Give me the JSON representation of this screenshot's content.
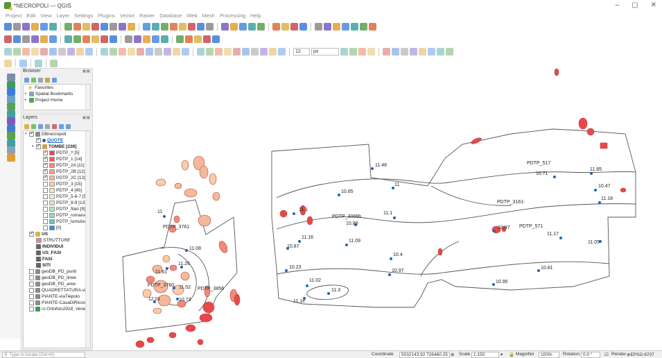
{
  "window": {
    "title": "*NECROPOLI — QGIS",
    "controls": [
      "–",
      "▢",
      "✕"
    ]
  },
  "menu": [
    "Project",
    "Edit",
    "View",
    "Layer",
    "Settings",
    "Plugins",
    "Vector",
    "Raster",
    "Database",
    "Web",
    "Mesh",
    "Processing",
    "Help"
  ],
  "toolbar": {
    "font_size_value": "12",
    "unit_value": "px"
  },
  "browser": {
    "title": "Browser",
    "items": [
      {
        "label": "Favorites",
        "icon": "star-icon"
      },
      {
        "label": "Spatial Bookmarks",
        "icon": "bookmark-icon"
      },
      {
        "label": "Project Home",
        "icon": "folder-icon"
      }
    ]
  },
  "layers": {
    "title": "Layers",
    "items": [
      {
        "label": "DBnecropoli",
        "indent": 0,
        "checked": true,
        "kind": "db",
        "expand": "▾"
      },
      {
        "label": "QUOTE",
        "indent": 1,
        "checked": true,
        "kind": "point",
        "bold": true,
        "underline": true,
        "color": "#1f63b7"
      },
      {
        "label": "TOMBE [228]",
        "indent": 1,
        "checked": true,
        "kind": "polygon",
        "bold": true,
        "expand": "▾"
      },
      {
        "label": "PDTP_? [5]",
        "indent": 2,
        "checked": true,
        "swatch": "#e9474b"
      },
      {
        "label": "PDTP_1 [14]",
        "indent": 2,
        "checked": true,
        "swatch": "#ea5f5e"
      },
      {
        "label": "PDTP_2A [11]",
        "indent": 2,
        "checked": true,
        "swatch": "#f08a78"
      },
      {
        "label": "PDTP_2B [12]",
        "indent": 2,
        "checked": true,
        "swatch": "#f1a087"
      },
      {
        "label": "PDTP_2C [13]",
        "indent": 2,
        "checked": true,
        "swatch": "#f4b89a"
      },
      {
        "label": "PDTP_3 [15]",
        "indent": 2,
        "checked": false,
        "swatch": "#f7cdaa"
      },
      {
        "label": "PDTP_4 [45]",
        "indent": 2,
        "checked": false,
        "swatch": "#fbe0bd"
      },
      {
        "label": "PDTP_5-6-7 [53]",
        "indent": 2,
        "checked": false,
        "swatch": "#eef0c8"
      },
      {
        "label": "PDTP_8-9 [13]",
        "indent": 2,
        "checked": false,
        "swatch": "#d4ecc4"
      },
      {
        "label": "PDTP_filari [9]",
        "indent": 2,
        "checked": false,
        "swatch": "#b9e0bf"
      },
      {
        "label": "PDTP_romana [26]",
        "indent": 2,
        "checked": false,
        "swatch": "#9bd3c3"
      },
      {
        "label": "PDTP_tumuloA [12",
        "indent": 2,
        "checked": false,
        "swatch": "#6fc0c8"
      },
      {
        "label": "[0]",
        "indent": 2,
        "checked": false,
        "swatch": "#2f8fd0"
      },
      {
        "label": "US",
        "indent": 0,
        "checked": true,
        "kind": "group",
        "bold": true
      },
      {
        "label": "STRUTTURE",
        "indent": 1,
        "checked": null,
        "swatch": "#e27fbf",
        "italic": true
      },
      {
        "label": "INDIVIDUI",
        "indent": 1,
        "checked": null,
        "kind": "table",
        "bold": true
      },
      {
        "label": "US_FASI",
        "indent": 1,
        "checked": null,
        "kind": "table",
        "bold": true
      },
      {
        "label": "FASI",
        "indent": 1,
        "checked": null,
        "kind": "table",
        "bold": true
      },
      {
        "label": "SITI",
        "indent": 1,
        "checked": null,
        "kind": "table",
        "bold": true
      },
      {
        "label": "geoDB_PD_punti",
        "indent": 0,
        "checked": false,
        "kind": "db"
      },
      {
        "label": "geoDB_PD_linee",
        "indent": 0,
        "checked": false,
        "kind": "db"
      },
      {
        "label": "geoDB_PD_aree",
        "indent": 0,
        "checked": false,
        "kind": "db"
      },
      {
        "label": "QUADRETTATURA-viaTiep",
        "indent": 0,
        "checked": false,
        "kind": "db"
      },
      {
        "label": "PIANTE-viaTiepolo",
        "indent": 0,
        "checked": false,
        "kind": "db"
      },
      {
        "label": "PIANTE-CasaDiRicovero",
        "indent": 0,
        "checked": false,
        "kind": "db"
      },
      {
        "label": "rs:Ortofoto2018_Veneto",
        "indent": 0,
        "checked": false,
        "kind": "raster",
        "italic": true
      }
    ]
  },
  "map": {
    "area_labels": [
      "PDTP_3761",
      "PDTP_3760",
      "PDTP_3856",
      "PDTP_3066b",
      "PDTP_3161-",
      "PDTP_517",
      "PDTP_571"
    ],
    "elevations": [
      "11",
      "11.08",
      "11.61",
      "11.26",
      "11.52",
      "12.01",
      "10.73",
      "11.48",
      "10.85",
      "11",
      "11.1",
      "10.88",
      "11.1",
      "11.16",
      "10.87",
      "11.09",
      "10.4",
      "10.23",
      "10.97",
      "11.02",
      "11.3",
      "11.1e",
      "10.71",
      "11.85",
      "10.47",
      "11.18",
      "10.97",
      "11.17",
      "11.05",
      "10.81",
      "10.95"
    ],
    "point_color": "#1f63b7",
    "tomb_colors": {
      "red": "#e9474b",
      "salmon": "#f08a78",
      "peach": "#f4b89a",
      "light": "#f7cdaa"
    }
  },
  "status": {
    "locator_placeholder": "Type to locate (Ctrl+K)",
    "coordinate_label": "Coordinate",
    "coordinate_value": "5032143.92 726460.25",
    "scale_label": "Scale",
    "scale_value": "1:150",
    "magnifier_label": "Magnifier",
    "magnifier_value": "100%",
    "rotation_label": "Rotation",
    "rotation_value": "0.0 °",
    "render_label": "Render",
    "crs_label": "EPSG:6707"
  }
}
